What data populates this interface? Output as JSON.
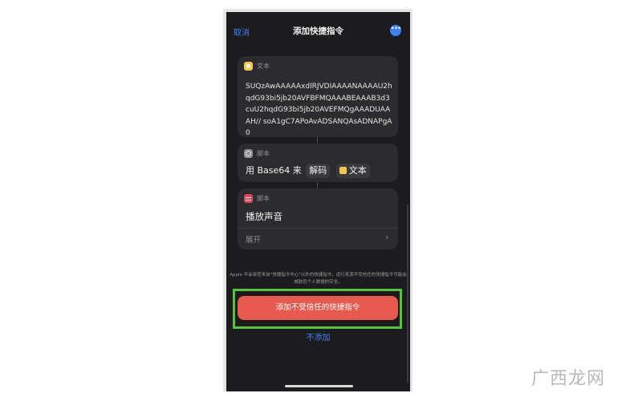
{
  "header": {
    "cancel_label": "取消",
    "title": "添加快捷指令",
    "more_label": "•••"
  },
  "actions": [
    {
      "category": "文本",
      "content": "SUQzAwAAAAAxdlRJVDIAAAANAAAAU2hqdG93bi5jb20AVFBFMQAAABEAAAB3d3cuU2hqdG93bi5jb20AVEFMQgAAADUAAAH// soA1gC7APoAvADSANQAsADNAPgA0"
    },
    {
      "category": "脚本",
      "prefix": "用 Base64 来",
      "mode": "解码",
      "variable": "文本"
    },
    {
      "category": "脚本",
      "title": "播放声音",
      "expand_label": "展开",
      "chevron": "›"
    }
  ],
  "notice": "Apple 不会审查来自\"快捷指令中心\"以外的快捷指令。运行来源不受信任的快捷指令可能会威胁您个人数据的安全。",
  "add_untrusted_label": "添加不受信任的快捷指令",
  "dont_add_label": "不添加",
  "watermark": "广西龙网",
  "colors": {
    "accent_blue": "#3b82f6",
    "danger_red": "#e85a4f",
    "highlight_green": "#56c43c",
    "background": "#1c1c1e",
    "card": "#2c2c2e"
  }
}
